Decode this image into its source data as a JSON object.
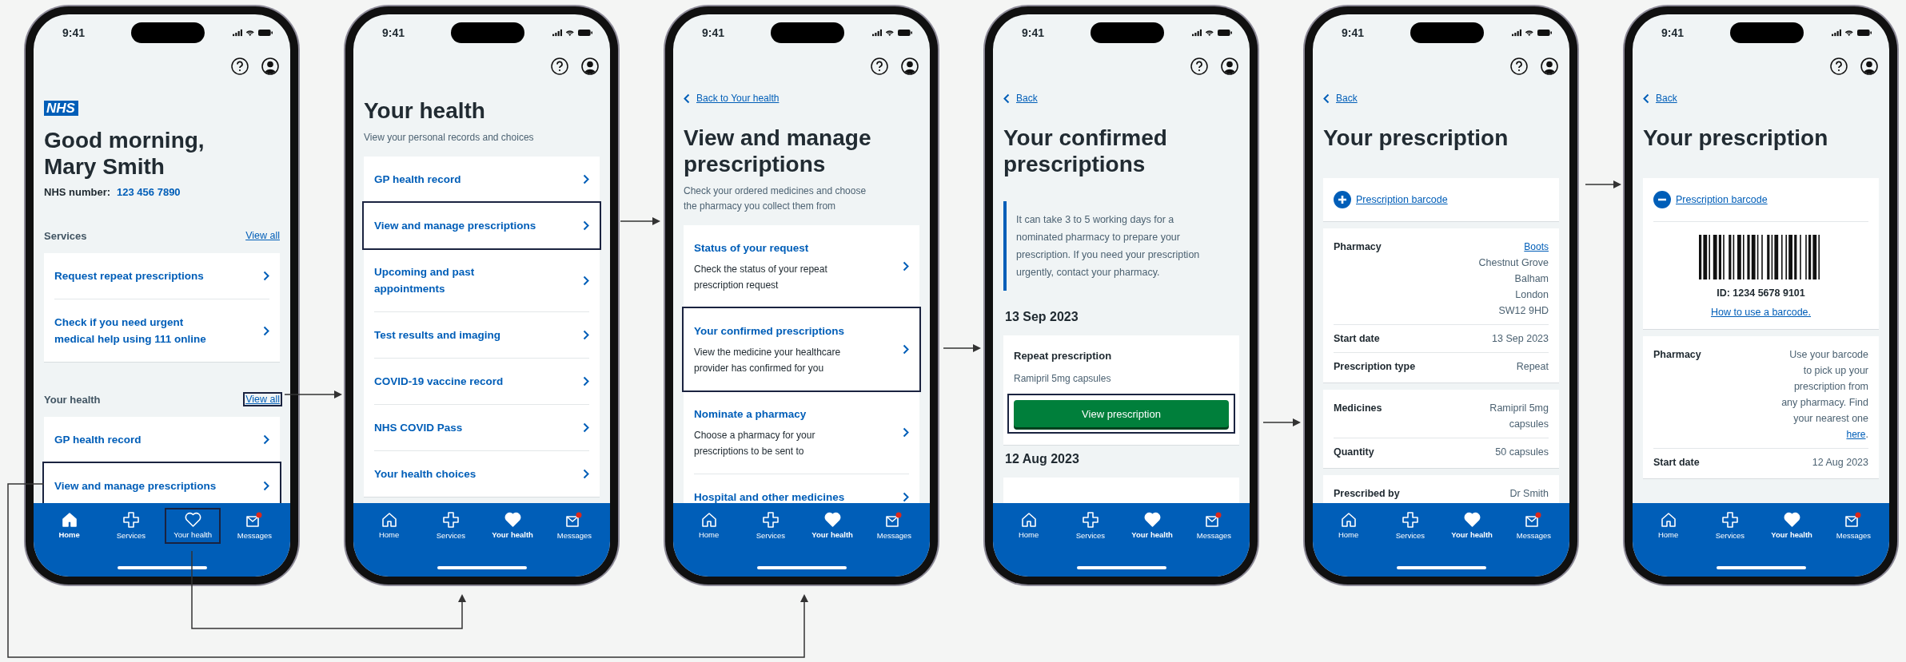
{
  "screens": [
    {
      "status_time": "9:41",
      "blocks": [
        {
          "kind": "logo",
          "text": "NHS"
        },
        {
          "kind": "heading",
          "lines": [
            "Good morning,",
            "Mary Smith"
          ]
        },
        {
          "kind": "patient_number",
          "label": "NHS number:",
          "value": "123 456 7890"
        },
        {
          "kind": "section",
          "title": "Services",
          "link": "View all",
          "highlighted": false
        },
        {
          "kind": "link_list",
          "items": [
            {
              "title": "Request repeat prescriptions",
              "highlighted": false
            },
            {
              "title": "Check if you need urgent\nmedical help using 111 online",
              "highlighted": false
            }
          ]
        },
        {
          "kind": "section",
          "title": "Your health",
          "link": "View all",
          "highlighted": true
        },
        {
          "kind": "link_list",
          "items": [
            {
              "title": "GP health record",
              "highlighted": false
            },
            {
              "title": "View and manage prescriptions",
              "highlighted": true
            }
          ]
        }
      ],
      "tabs": [
        {
          "label": "Home",
          "selected": true,
          "highlighted": false
        },
        {
          "label": "Services",
          "selected": false,
          "highlighted": false
        },
        {
          "label": "Your health",
          "selected": false,
          "highlighted": true
        },
        {
          "label": "Messages",
          "selected": false,
          "highlighted": false
        }
      ]
    },
    {
      "status_time": "9:41",
      "blocks": [
        {
          "kind": "heading",
          "lines": [
            "Your health"
          ]
        },
        {
          "kind": "subtitle",
          "text": "View your personal records and choices"
        },
        {
          "kind": "link_list",
          "items": [
            {
              "title": "GP health record",
              "highlighted": false
            },
            {
              "title": "View and manage prescriptions",
              "highlighted": true
            },
            {
              "title": "Upcoming and past\nappointments",
              "highlighted": false
            },
            {
              "title": "Test results and imaging",
              "highlighted": false
            },
            {
              "title": "COVID-19 vaccine record",
              "highlighted": false
            },
            {
              "title": "NHS COVID Pass",
              "highlighted": false
            },
            {
              "title": "Your health choices",
              "highlighted": false
            }
          ]
        }
      ],
      "tabs": [
        {
          "label": "Home",
          "selected": false,
          "highlighted": false
        },
        {
          "label": "Services",
          "selected": false,
          "highlighted": false
        },
        {
          "label": "Your health",
          "selected": true,
          "highlighted": false
        },
        {
          "label": "Messages",
          "selected": false,
          "highlighted": false
        }
      ]
    },
    {
      "status_time": "9:41",
      "blocks": [
        {
          "kind": "back",
          "label": "Back to Your health"
        },
        {
          "kind": "heading",
          "lines": [
            "View and manage",
            "prescriptions"
          ]
        },
        {
          "kind": "subtitle",
          "text": "Check your ordered medicines and choose\nthe pharmacy you collect them from"
        },
        {
          "kind": "link_list",
          "items": [
            {
              "title": "Status of your request",
              "description": "Check the status of your repeat\nprescription request",
              "highlighted": false
            },
            {
              "title": "Your confirmed prescriptions",
              "description": "View the medicine your healthcare\nprovider has confirmed for you",
              "highlighted": true
            },
            {
              "title": "Nominate a pharmacy",
              "description": "Choose a pharmacy for your\nprescriptions to be sent to",
              "highlighted": false
            },
            {
              "title": "Hospital and other medicines",
              "highlighted": false
            }
          ]
        }
      ],
      "tabs": [
        {
          "label": "Home",
          "selected": false,
          "highlighted": false
        },
        {
          "label": "Services",
          "selected": false,
          "highlighted": false
        },
        {
          "label": "Your health",
          "selected": true,
          "highlighted": false
        },
        {
          "label": "Messages",
          "selected": false,
          "highlighted": false
        }
      ]
    },
    {
      "status_time": "9:41",
      "blocks": [
        {
          "kind": "back",
          "label": "Back"
        },
        {
          "kind": "heading",
          "lines": [
            "Your confirmed",
            "prescriptions"
          ]
        },
        {
          "kind": "inset",
          "text": "It can take 3 to 5 working days for a\nnominated pharmacy to prepare your\nprescription. If you need your prescription\nurgently, contact your pharmacy."
        },
        {
          "kind": "date",
          "text": "13 Sep 2023"
        },
        {
          "kind": "prescription",
          "title": "Repeat prescription",
          "medicine": "Ramipril 5mg capsules",
          "button": "View prescription",
          "highlighted": true
        },
        {
          "kind": "date",
          "text": "12 Aug 2023"
        },
        {
          "kind": "card_stub"
        }
      ],
      "tabs": [
        {
          "label": "Home",
          "selected": false,
          "highlighted": false
        },
        {
          "label": "Services",
          "selected": false,
          "highlighted": false
        },
        {
          "label": "Your health",
          "selected": true,
          "highlighted": false
        },
        {
          "label": "Messages",
          "selected": false,
          "highlighted": false
        }
      ]
    },
    {
      "status_time": "9:41",
      "blocks": [
        {
          "kind": "back",
          "label": "Back"
        },
        {
          "kind": "heading",
          "lines": [
            "Your prescription"
          ]
        },
        {
          "kind": "expander",
          "label": "Prescription barcode",
          "expanded": false
        },
        {
          "kind": "summary",
          "rows": [
            {
              "key": "Pharmacy",
              "value": [
                {
                  "link": "Boots"
                },
                {
                  "line": "Chestnut Grove"
                },
                {
                  "line": "Balham"
                },
                {
                  "line": "London"
                },
                {
                  "line": "SW12 9HD"
                }
              ]
            },
            {
              "key": "Start date",
              "value": [
                {
                  "line": "13 Sep 2023"
                }
              ]
            },
            {
              "key": "Prescription type",
              "value": [
                {
                  "line": "Repeat"
                }
              ]
            }
          ]
        },
        {
          "kind": "summary",
          "rows": [
            {
              "key": "Medicines",
              "value": [
                {
                  "line": "Ramipril 5mg\ncapsules"
                }
              ]
            },
            {
              "key": "Quantity",
              "value": [
                {
                  "line": "50 capsules"
                }
              ]
            }
          ]
        },
        {
          "kind": "summary",
          "rows": [
            {
              "key": "Prescribed by",
              "value": [
                {
                  "line": "Dr Smith"
                }
              ]
            }
          ]
        }
      ],
      "tabs": [
        {
          "label": "Home",
          "selected": false,
          "highlighted": false
        },
        {
          "label": "Services",
          "selected": false,
          "highlighted": false
        },
        {
          "label": "Your health",
          "selected": true,
          "highlighted": false
        },
        {
          "label": "Messages",
          "selected": false,
          "highlighted": false
        }
      ]
    },
    {
      "status_time": "9:41",
      "blocks": [
        {
          "kind": "back",
          "label": "Back"
        },
        {
          "kind": "heading",
          "lines": [
            "Your prescription"
          ]
        },
        {
          "kind": "expander",
          "label": "Prescription barcode",
          "expanded": true,
          "barcode_id": "ID: 1234 5678 9101",
          "help_link": "How to use a barcode."
        },
        {
          "kind": "summary",
          "rows": [
            {
              "key": "Pharmacy",
              "value": [
                {
                  "text": "Use your barcode\nto pick up your\nprescription from\nany pharmacy. Find\nyour nearest one\n"
                },
                {
                  "link": "here"
                },
                {
                  "text": "."
                }
              ]
            },
            {
              "key": "Start date",
              "value": [
                {
                  "line": "12 Aug 2023"
                }
              ]
            }
          ]
        }
      ],
      "tabs": [
        {
          "label": "Home",
          "selected": false,
          "highlighted": false
        },
        {
          "label": "Services",
          "selected": false,
          "highlighted": false
        },
        {
          "label": "Your health",
          "selected": true,
          "highlighted": false
        },
        {
          "label": "Messages",
          "selected": false,
          "highlighted": false
        }
      ]
    }
  ]
}
